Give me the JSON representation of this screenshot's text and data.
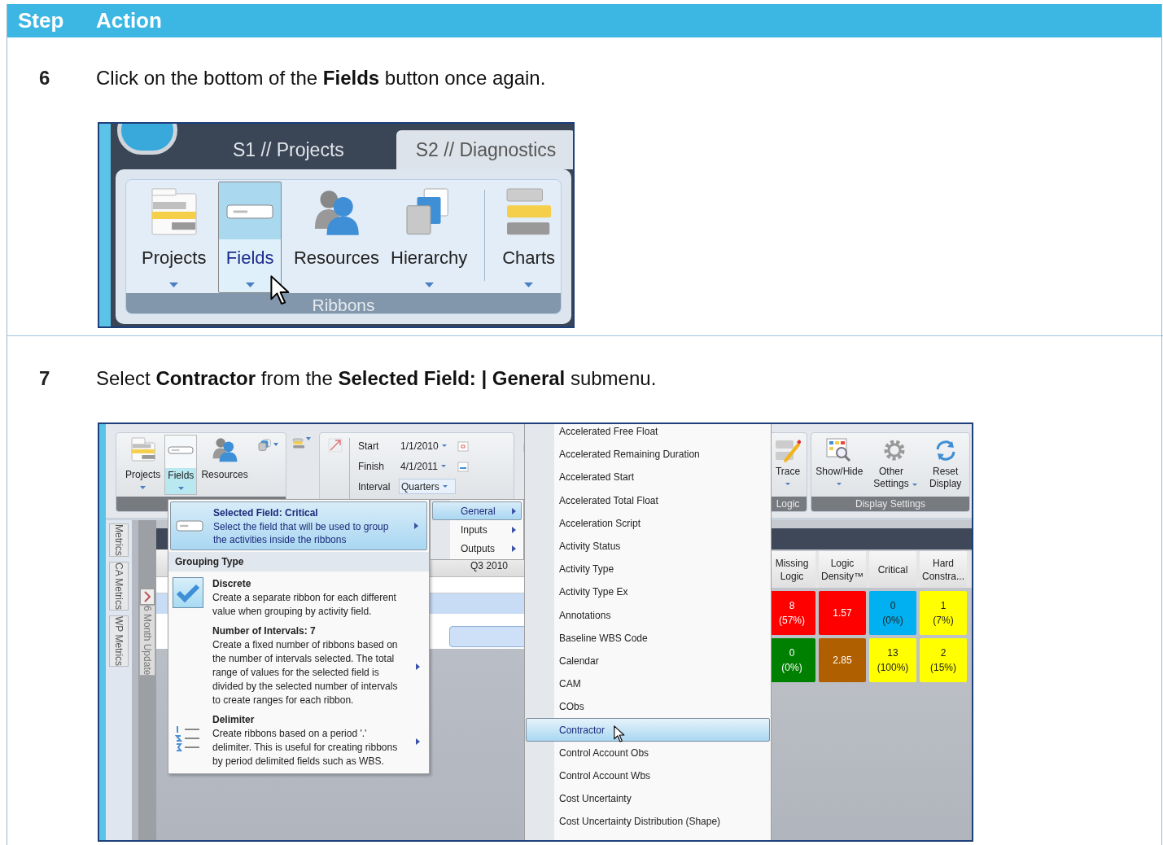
{
  "header": {
    "columns": [
      "Step",
      "Action"
    ]
  },
  "steps": [
    {
      "number": "6",
      "instruction": "Click on the bottom of the **Fields** button once again.",
      "screenshot": {
        "kind": "ribbon",
        "tabs": [
          {
            "label": "S1 // Projects",
            "selected": false
          },
          {
            "label": "S2 // Diagnostics",
            "selected": true
          }
        ],
        "buttons": [
          {
            "label": "Projects",
            "selected": false,
            "dropdown": true
          },
          {
            "label": "Fields",
            "selected": true,
            "dropdown": true
          },
          {
            "label": "Resources",
            "selected": false,
            "dropdown": false
          },
          {
            "label": "Hierarchy",
            "selected": false,
            "dropdown": true
          },
          {
            "label": "Charts",
            "selected": false,
            "dropdown": true
          }
        ],
        "group": "Ribbons"
      }
    },
    {
      "number": "7",
      "instruction": "Select **Contractor** from the **Selected Field: | General** submenu.",
      "screenshot": {
        "kind": "menu",
        "ribbon_buttons": [
          {
            "label": "Projects",
            "selected": false,
            "dropdown": true
          },
          {
            "label": "Fields",
            "selected": true,
            "dropdown": true
          },
          {
            "label": "Resources",
            "selected": false,
            "dropdown": false
          }
        ],
        "dates": [
          {
            "label": "Start",
            "value": "1/1/2010"
          },
          {
            "label": "Finish",
            "value": "4/1/2011"
          },
          {
            "label": "Interval",
            "value": "Quarters"
          }
        ],
        "right_groups": [
          {
            "name": "Logic",
            "buttons": [
              {
                "label": "Trace",
                "dropdown": true
              }
            ]
          },
          {
            "name": "Display Settings",
            "buttons": [
              {
                "label": "Show/Hide",
                "dropdown": true
              },
              {
                "label": "Other Settings",
                "dropdown": true
              },
              {
                "label": "Reset Display",
                "dropdown": false
              }
            ]
          }
        ],
        "side_tabs": [
          "Metrics",
          "CA Metrics",
          "WP Metrics"
        ],
        "view_tab": "6 Month Update",
        "period": "Q3 2010",
        "fields_menu": {
          "selected": true,
          "title": "Selected Field: Critical",
          "description": "Select the field that will be used to group the activities inside the ribbons",
          "section": "Grouping Type",
          "options": [
            {
              "title": "Discrete",
              "description": "Create a separate ribbon for each different value when grouping by activity field.",
              "checked": true,
              "submenu": false,
              "selected": false
            },
            {
              "title": "Number of Intervals: 7",
              "description": "Create a fixed number of ribbons based on the number of intervals selected. The total range of values for the selected field is divided by the selected number of intervals to create ranges for each ribbon.",
              "checked": false,
              "submenu": true,
              "selected": false
            },
            {
              "title": "Delimiter",
              "description": "Create ribbons based on a period '.' delimiter. This is useful for creating ribbons by period delimited fields such as WBS.",
              "checked": false,
              "submenu": true,
              "selected": false
            }
          ]
        },
        "submenu": [
          {
            "label": "General",
            "selected": true
          },
          {
            "label": "Inputs",
            "selected": false
          },
          {
            "label": "Outputs",
            "selected": false
          }
        ],
        "field_list": [
          {
            "label": "Accelerated Free Float",
            "selected": false
          },
          {
            "label": "Accelerated Remaining Duration",
            "selected": false
          },
          {
            "label": "Accelerated Start",
            "selected": false
          },
          {
            "label": "Accelerated Total Float",
            "selected": false
          },
          {
            "label": "Acceleration Script",
            "selected": false
          },
          {
            "label": "Activity Status",
            "selected": false
          },
          {
            "label": "Activity Type",
            "selected": false
          },
          {
            "label": "Activity Type Ex",
            "selected": false
          },
          {
            "label": "Annotations",
            "selected": false
          },
          {
            "label": "Baseline WBS Code",
            "selected": false
          },
          {
            "label": "Calendar",
            "selected": false
          },
          {
            "label": "CAM",
            "selected": false
          },
          {
            "label": "CObs",
            "selected": false
          },
          {
            "label": "Contractor",
            "selected": true
          },
          {
            "label": "Control Account Obs",
            "selected": false
          },
          {
            "label": "Control Account Wbs",
            "selected": false
          },
          {
            "label": "Cost Uncertainty",
            "selected": false
          },
          {
            "label": "Cost Uncertainty Distribution (Shape)",
            "selected": false
          }
        ],
        "metrics": {
          "columns": [
            "Missing Logic",
            "Logic Density™",
            "Critical",
            "Hard Constra..."
          ],
          "rows": [
            [
              {
                "value": "8",
                "percent": "(57%)",
                "color": "#ff0000"
              },
              {
                "value": "1.57",
                "color": "#ff0000"
              },
              {
                "value": "0",
                "percent": "(0%)",
                "color": "#00b0f0"
              },
              {
                "value": "1",
                "percent": "(7%)",
                "color": "#ffff00"
              }
            ],
            [
              {
                "value": "0",
                "percent": "(0%)",
                "color": "#008000"
              },
              {
                "value": "2.85",
                "color": "#b05f00"
              },
              {
                "value": "13",
                "percent": "(100%)",
                "color": "#ffff00"
              },
              {
                "value": "2",
                "percent": "(15%)",
                "color": "#ffff00"
              }
            ]
          ]
        }
      }
    }
  ]
}
